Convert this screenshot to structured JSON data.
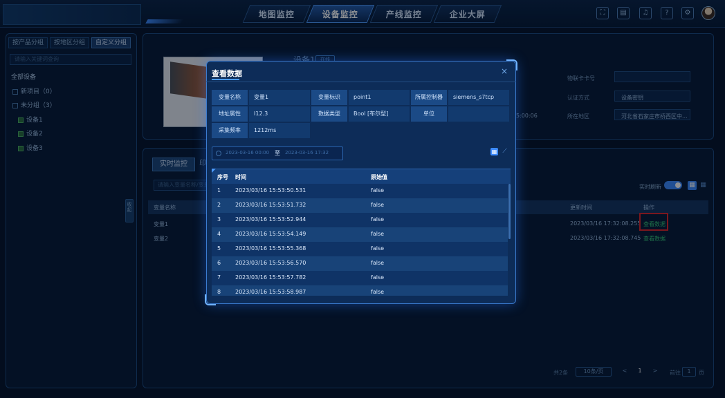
{
  "nav": {
    "tabs": [
      {
        "label": "地图监控"
      },
      {
        "label": "设备监控"
      },
      {
        "label": "产线监控"
      },
      {
        "label": "企业大屏"
      }
    ],
    "tool_icons": [
      "fullscreen-icon",
      "message-icon",
      "bell-icon",
      "help-icon",
      "gear-icon"
    ]
  },
  "left": {
    "tabs": [
      "按产品分组",
      "按地区分组",
      "自定义分组"
    ],
    "search_placeholder": "请输入关键词查询",
    "tree": {
      "root": "全部设备",
      "items": [
        {
          "label": "新项目（0）"
        },
        {
          "label": "未分组（3）"
        },
        {
          "label": "设备1"
        },
        {
          "label": "设备2"
        },
        {
          "label": "设备3"
        }
      ]
    },
    "collapse_label": "收起"
  },
  "device": {
    "name": "设备1",
    "badge": "在线",
    "info": {
      "iot_card_label": "物联卡卡号",
      "iot_card_value": "",
      "auth_label": "认证方式",
      "auth_value": "设备密钥",
      "time_value": "5:00:06",
      "region_label": "所在地区",
      "region_value": "河北省石家庄市桥西区中..."
    }
  },
  "monitor": {
    "tab_active": "实时监控",
    "tab_other": "印",
    "search_placeholder": "请输入变量名称/变量标识",
    "auto_refresh_label": "实时刷新",
    "columns": [
      "变量名称",
      "更新时间",
      "操作"
    ],
    "rows": [
      {
        "name": "变量1",
        "time": "2023/03/16 17:32:08.255",
        "action": "查看数据"
      },
      {
        "name": "变量2",
        "time": "2023/03/16 17:32:08.745",
        "action": "查看数据"
      }
    ],
    "pagination": {
      "total": "共2条",
      "page_size": "10条/页",
      "prev": "<",
      "current": "1",
      "next": ">",
      "goto_label": "前往",
      "goto_value": "1",
      "page_unit": "页"
    }
  },
  "modal": {
    "title": "查看数据",
    "close": "×",
    "fields": {
      "var_name_label": "变量名称",
      "var_name_value": "变量1",
      "var_id_label": "变量标识",
      "var_id_value": "point1",
      "controller_label": "所属控制器",
      "controller_value": "siemens_s7tcp",
      "address_label": "地址属性",
      "address_value": "I12.3",
      "data_type_label": "数据类型",
      "data_type_value": "Bool [布尔型]",
      "unit_label": "单位",
      "unit_value": "",
      "freq_label": "采集频率",
      "freq_value": "1212ms"
    },
    "date_range": {
      "start": "2023-03-16 00:00",
      "separator": "至",
      "end": "2023-03-16 17:32"
    },
    "table": {
      "columns": [
        "序号",
        "时间",
        "原始值"
      ],
      "rows": [
        {
          "no": "1",
          "time": "2023/03/16 15:53:50.531",
          "value": "false"
        },
        {
          "no": "2",
          "time": "2023/03/16 15:53:51.732",
          "value": "false"
        },
        {
          "no": "3",
          "time": "2023/03/16 15:53:52.944",
          "value": "false"
        },
        {
          "no": "4",
          "time": "2023/03/16 15:53:54.149",
          "value": "false"
        },
        {
          "no": "5",
          "time": "2023/03/16 15:53:55.368",
          "value": "false"
        },
        {
          "no": "6",
          "time": "2023/03/16 15:53:56.570",
          "value": "false"
        },
        {
          "no": "7",
          "time": "2023/03/16 15:53:57.782",
          "value": "false"
        },
        {
          "no": "8",
          "time": "2023/03/16 15:53:58.987",
          "value": "false"
        }
      ]
    }
  },
  "colors": {
    "background": "#06132a",
    "accent": "#3d8bff",
    "link_green": "#38c979",
    "highlight_red": "#e0262a"
  }
}
